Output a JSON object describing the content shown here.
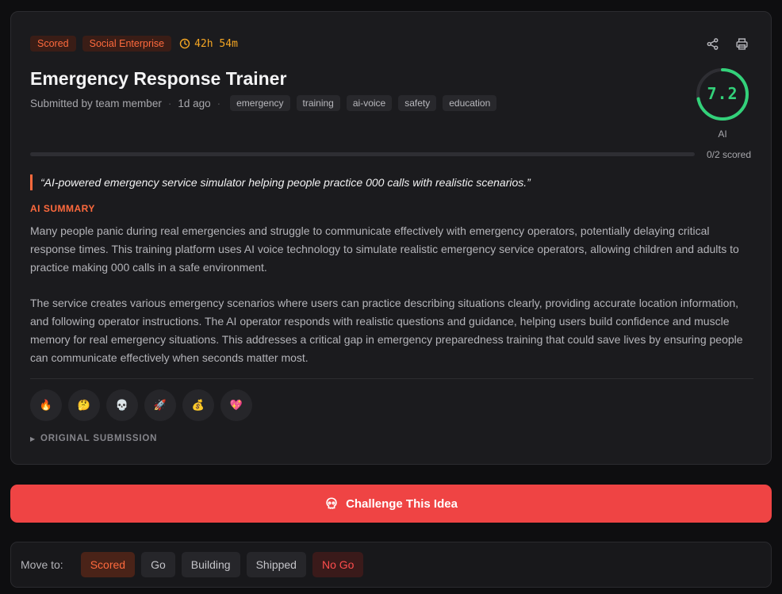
{
  "header": {
    "status_badge": "Scored",
    "category_badge": "Social Enterprise",
    "timer": "42h 54m",
    "title": "Emergency Response Trainer",
    "submitted_by": "Submitted by team member",
    "time_ago": "1d ago",
    "tags": [
      "emergency",
      "training",
      "ai-voice",
      "safety",
      "education"
    ]
  },
  "score": {
    "value": "7.2",
    "value_num": 7.2,
    "max": 10,
    "label": "AI"
  },
  "progress": {
    "text": "0/2 scored",
    "fraction": 0
  },
  "quote": "“AI-powered emergency service simulator helping people practice 000 calls with realistic scenarios.”",
  "summary": {
    "label": "AI SUMMARY",
    "paragraphs": [
      "Many people panic during real emergencies and struggle to communicate effectively with emergency operators, potentially delaying critical response times. This training platform uses AI voice technology to simulate realistic emergency service operators, allowing children and adults to practice making 000 calls in a safe environment.",
      "The service creates various emergency scenarios where users can practice describing situations clearly, providing accurate location information, and following operator instructions. The AI operator responds with realistic questions and guidance, helping users build confidence and muscle memory for real emergency situations. This addresses a critical gap in emergency preparedness training that could save lives by ensuring people can communicate effectively when seconds matter most."
    ]
  },
  "reactions": [
    "🔥",
    "🤔",
    "💀",
    "🚀",
    "💰",
    "💖"
  ],
  "original_submission": "ORIGINAL SUBMISSION",
  "challenge_button": "Challenge This Idea",
  "move_to": {
    "label": "Move to:",
    "options": [
      "Scored",
      "Go",
      "Building",
      "Shipped",
      "No Go"
    ]
  },
  "colors": {
    "accent": "#ff6a3d",
    "score": "#33d17a",
    "challenge": "#ef4444",
    "timer": "#f5a623"
  }
}
